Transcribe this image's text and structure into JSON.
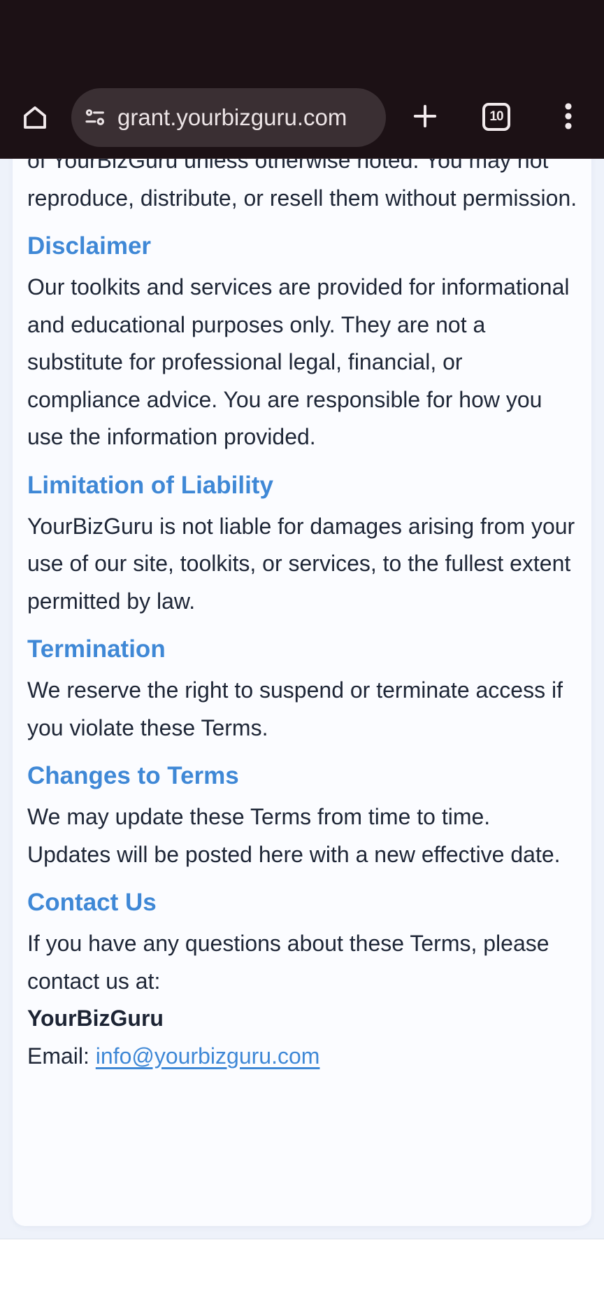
{
  "browser": {
    "url": "grant.yourbizguru.com",
    "tab_count": "10",
    "icons": {
      "home": "home-icon",
      "site_info": "site-settings-icon",
      "new_tab": "plus-icon",
      "tabs": "tab-switcher-icon",
      "menu": "more-vert-icon"
    }
  },
  "content": {
    "intro_paragraph": "of YourBizGuru unless otherwise noted. You may not reproduce, distribute, or resell them without permission.",
    "sections": [
      {
        "heading": "Disclaimer",
        "body": "Our toolkits and services are provided for informational and educational purposes only. They are not a substitute for professional legal, financial, or compliance advice. You are responsible for how you use the information provided."
      },
      {
        "heading": "Limitation of Liability",
        "body": "YourBizGuru is not liable for damages arising from your use of our site, toolkits, or services, to the fullest extent permitted by law."
      },
      {
        "heading": "Termination",
        "body": "We reserve the right to suspend or terminate access if you violate these Terms."
      },
      {
        "heading": "Changes to Terms",
        "body": "We may update these Terms from time to time. Updates will be posted here with a new effective date."
      },
      {
        "heading": "Contact Us",
        "body": "If you have any questions about these Terms, please contact us at:"
      }
    ],
    "contact": {
      "company": "YourBizGuru",
      "email_label": "Email:",
      "email": "info@yourbizguru.com"
    }
  },
  "colors": {
    "browser_bar": "#1c1115",
    "omnibox": "#3a2f33",
    "heading": "#3f88d6",
    "body_text": "#1e2636",
    "link": "#3f88d6",
    "page_background": "#eef2fa",
    "card_background": "#fbfcff"
  }
}
